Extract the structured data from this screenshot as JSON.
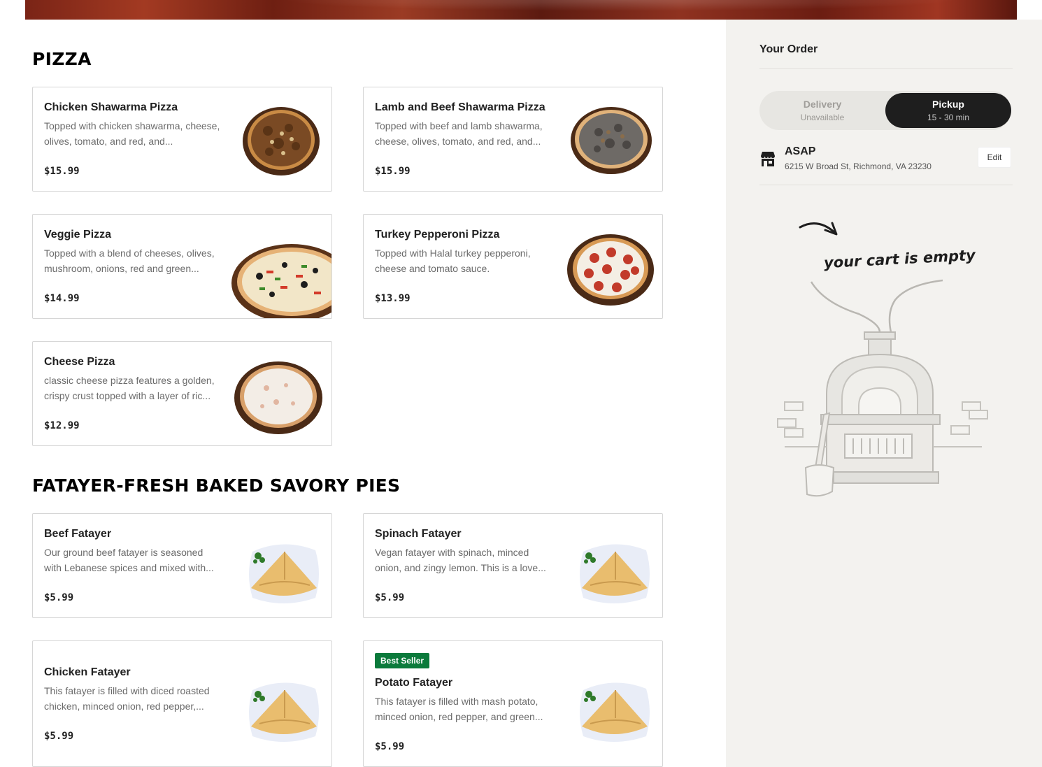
{
  "sections": [
    {
      "title": "PIZZA",
      "items": [
        {
          "name": "Chicken Shawarma Pizza",
          "desc": "Topped with chicken shawarma, cheese, olives, tomato, and red, and...",
          "price": "$15.99"
        },
        {
          "name": "Lamb and Beef Shawarma Pizza",
          "desc": "Topped with beef and lamb shawarma, cheese, olives, tomato, and red, and...",
          "price": "$15.99"
        },
        {
          "name": "Veggie Pizza",
          "desc": "Topped with a blend of cheeses, olives, mushroom, onions, red and green...",
          "price": "$14.99"
        },
        {
          "name": "Turkey Pepperoni Pizza",
          "desc": "Topped with Halal turkey pepperoni, cheese and tomato sauce.",
          "price": "$13.99"
        },
        {
          "name": "Cheese Pizza",
          "desc": "classic cheese pizza features a golden, crispy crust topped with a layer of ric...",
          "price": "$12.99"
        }
      ]
    },
    {
      "title": "FATAYER-FRESH BAKED SAVORY PIES",
      "items": [
        {
          "name": "Beef Fatayer",
          "desc": "Our ground beef fatayer is seasoned with Lebanese spices and mixed with...",
          "price": "$5.99"
        },
        {
          "name": "Spinach Fatayer",
          "desc": "Vegan fatayer with spinach, minced onion, and zingy lemon. This is a love...",
          "price": "$5.99"
        },
        {
          "name": "Chicken Fatayer",
          "desc": "This fatayer is filled with diced roasted chicken, minced onion, red pepper,...",
          "price": "$5.99"
        },
        {
          "name": "Potato Fatayer",
          "badge": "Best Seller",
          "desc": "This fatayer is filled with mash potato, minced onion, red pepper, and green...",
          "price": "$5.99"
        }
      ]
    }
  ],
  "order": {
    "title": "Your Order",
    "delivery_label": "Delivery",
    "delivery_sub": "Unavailable",
    "pickup_label": "Pickup",
    "pickup_sub": "15 - 30 min",
    "selected_mode": "pickup",
    "time_label": "ASAP",
    "address": "6215 W Broad St, Richmond, VA 23230",
    "edit_label": "Edit",
    "empty_cart_text": "your cart is empty"
  },
  "icons": {
    "store": "store-icon",
    "empty_cart_illustration": "pizza-oven-illustration"
  },
  "colors": {
    "badge": "#0b7a3b",
    "pickup_active": "#1e1e1e",
    "panel_bg": "#f3f2ef"
  }
}
